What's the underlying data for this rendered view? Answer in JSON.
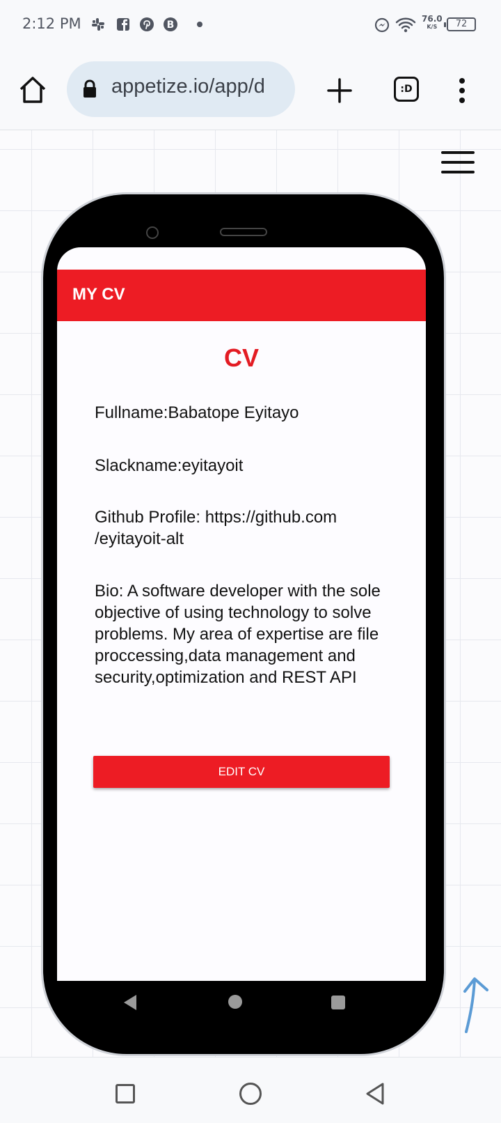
{
  "status_bar": {
    "time": "2:12 PM",
    "notification_icons": [
      "slack-icon",
      "facebook-icon",
      "pinterest-icon",
      "b-icon",
      "dot-icon"
    ],
    "net_speed": "76.0",
    "net_speed_unit": "K/S",
    "battery": "72"
  },
  "browser": {
    "url": "appetize.io/app/d",
    "tabs_label": ":D"
  },
  "app": {
    "title": "MY CV",
    "heading": "CV",
    "fullname": "Fullname:Babatope Eyitayo",
    "slackname": "Slackname:eyitayoit",
    "github": "Github Profile: https://github.com /eyitayoit-alt",
    "bio": "Bio: A software developer with the sole objective of using technology to solve problems. My area of expertise are file proccessing,data management and security,optimization and REST API",
    "edit_button": "EDIT CV",
    "accent_color": "#ed1c24"
  }
}
